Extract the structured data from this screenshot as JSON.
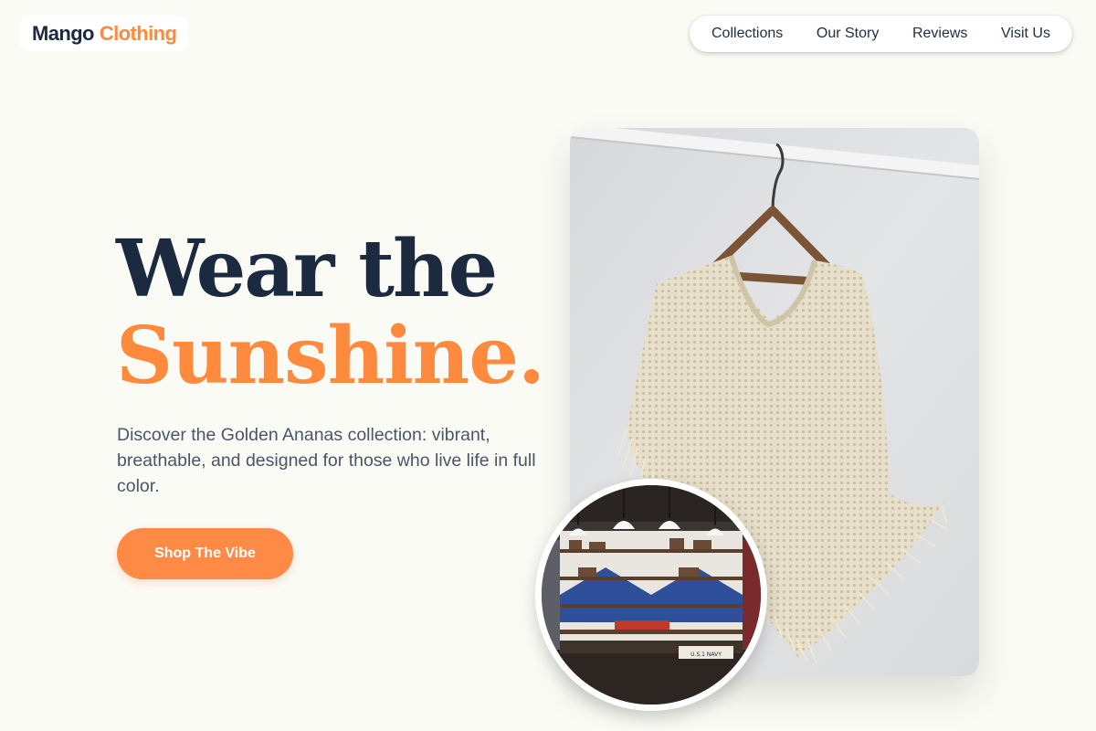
{
  "brand": {
    "name_part1": "Mango",
    "name_part2": "Clothing",
    "accent_color": "#ff8a3d",
    "dark_color": "#1c2a3f"
  },
  "nav": {
    "items": [
      "Collections",
      "Our Story",
      "Reviews",
      "Visit Us"
    ]
  },
  "hero": {
    "headline_line1": "Wear the",
    "headline_line2": "Sunshine.",
    "description": "Discover the Golden Ananas collection: vibrant, breathable, and designed for those who live life in full color.",
    "cta_label": "Shop The Vibe"
  },
  "images": {
    "main": "photo of a cream crochet poncho with fringe hanging on a wooden hanger",
    "inset": "photo of a clothing store interior with shelves and pendant lamps"
  },
  "inset_sign": "U.S.1 NAVY"
}
